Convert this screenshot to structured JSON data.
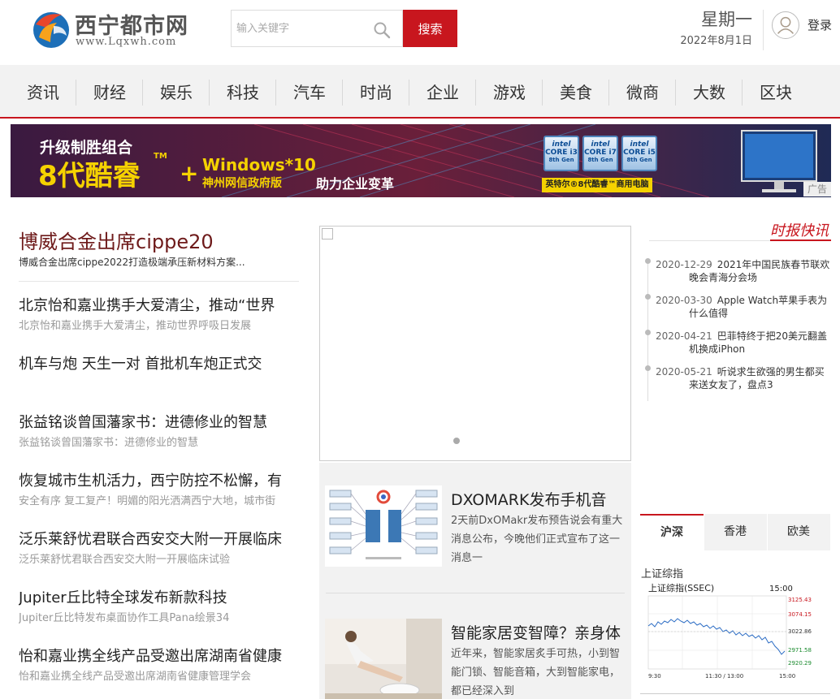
{
  "header": {
    "logo_title": "西宁都市网",
    "logo_sub": "www.Lqxwh.com",
    "search_placeholder": "输入关键字",
    "search_button": "搜索",
    "weekday": "星期一",
    "date": "2022年8月1日",
    "login": "登录"
  },
  "nav": [
    "资讯",
    "财经",
    "娱乐",
    "科技",
    "汽车",
    "时尚",
    "企业",
    "游戏",
    "美食",
    "微商",
    "大数",
    "区块"
  ],
  "banner": {
    "line1": "升级制胜组合",
    "line2a": "8代酷睿",
    "tm": "TM",
    "plus": "+",
    "windows": "Windows*10",
    "gov": "神州网信政府版",
    "help": "助力企业变革",
    "chips": [
      {
        "brand": "intel",
        "model": "CORE i3",
        "gen": "8th Gen"
      },
      {
        "brand": "intel",
        "model": "CORE i7",
        "gen": "8th Gen"
      },
      {
        "brand": "intel",
        "model": "CORE i5",
        "gen": "8th Gen"
      }
    ],
    "tag": "英特尔®8代酷睿™商用电脑",
    "ad_label": "广告"
  },
  "left": {
    "headline": "博威合金出席cippe20",
    "headline_sub": "博威合金出席cippe2022打造极端承压新材料方案...",
    "items": [
      {
        "title": "北京怡和嘉业携手大爱清尘，推动“世界",
        "desc": "北京怡和嘉业携手大爱清尘，推动世界呼吸日发展"
      },
      {
        "title": "机车与炮 天生一对 首批机车炮正式交",
        "desc": ""
      },
      {
        "title": "张益铭谈曾国藩家书：进德修业的智慧",
        "desc": "张益铭谈曾国藩家书：进德修业的智慧"
      },
      {
        "title": "恢复城市生机活力，西宁防控不松懈，有",
        "desc": "安全有序 复工复产！明媚的阳光洒满西宁大地，城市街"
      },
      {
        "title": "泛乐莱舒忧君联合西安交大附一开展临床",
        "desc": "泛乐莱舒忧君联合西安交大附一开展临床试验"
      },
      {
        "title": "Jupiter丘比特全球发布新款科技",
        "desc": "Jupiter丘比特发布桌面协作工具Pana绘景34"
      },
      {
        "title": "怡和嘉业携全线产品受邀出席湖南省健康",
        "desc": "怡和嘉业携全线产品受邀出席湖南省健康管理学会"
      }
    ]
  },
  "middle": {
    "items": [
      {
        "title": "DXOMARK发布手机音",
        "desc": "2天前DxOMakr发布预告说会有重大消息公布，今晚他们正式宣布了这一消息一"
      },
      {
        "title": "智能家居变智障？亲身体",
        "desc": "近年来，智能家居炙手可热，小到智能门锁、智能音箱，大到智能家电，都已经深入到"
      }
    ]
  },
  "right": {
    "title": "时报快讯",
    "flash": [
      {
        "date": "2020-12-29",
        "text": "2021年中国民族春节联欢晚会青海分会场"
      },
      {
        "date": "2020-03-30",
        "text": "Apple Watch苹果手表为什么值得"
      },
      {
        "date": "2020-04-21",
        "text": "巴菲特终于把20美元翻盖机换成iPhon"
      },
      {
        "date": "2020-05-21",
        "text": "听说求生欲强的男生都买来送女友了，盘点3"
      }
    ],
    "tabs": [
      "沪深",
      "香港",
      "欧美"
    ],
    "index_label": "上证综指",
    "stock": {
      "name": "上证综指(SSEC)",
      "time": "15:00",
      "prices": [
        "3125.43",
        "3074.15",
        "3022.86",
        "2971.58",
        "2920.29"
      ],
      "xticks": [
        "9:30",
        "11:30 / 13:00",
        "15:00"
      ]
    }
  }
}
